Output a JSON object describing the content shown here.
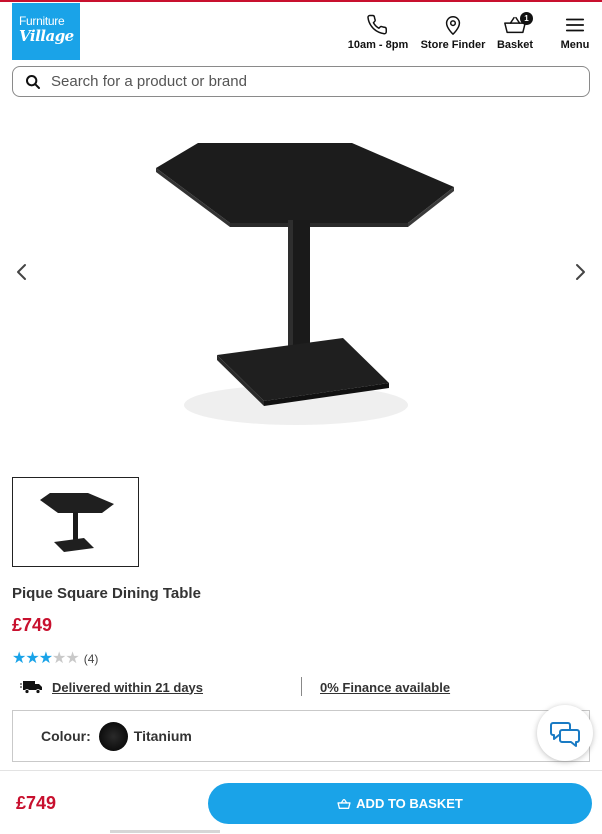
{
  "brand": {
    "line1": "Furniture",
    "line2": "Village",
    "color": "#1aa3e8"
  },
  "header": {
    "hours_label": "10am - 8pm",
    "store_finder_label": "Store Finder",
    "basket_label": "Basket",
    "basket_count": "1",
    "menu_label": "Menu"
  },
  "search": {
    "placeholder": "Search for a product or brand"
  },
  "product": {
    "name": "Pique Square Dining Table",
    "price": "£749",
    "rating": 3,
    "rating_max": 5,
    "review_count": "(4)",
    "delivery": "Delivered within 21 days",
    "finance": "0% Finance available",
    "colour_label": "Colour:",
    "colour_value": "Titanium"
  },
  "bottom_bar": {
    "price": "£749",
    "add_to_basket_label": "ADD TO BASKET"
  },
  "colors": {
    "accent": "#1aa3e8",
    "price": "#c8102e"
  }
}
